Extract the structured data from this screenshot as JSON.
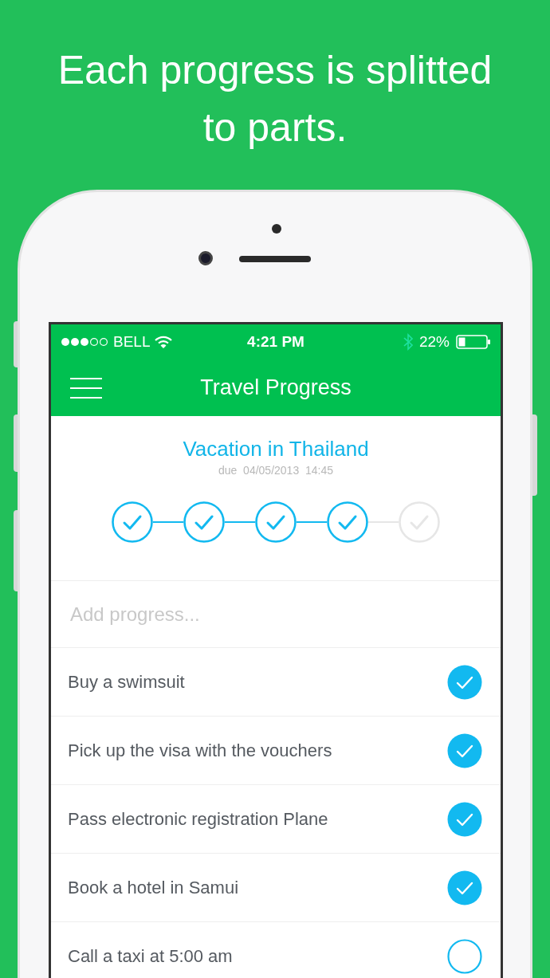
{
  "headline": "Each progress is splitted to parts.",
  "status_bar": {
    "carrier": "BELL",
    "time": "4:21 PM",
    "battery": "22%"
  },
  "nav": {
    "title": "Travel Progress"
  },
  "goal": {
    "title": "Vacation in Thailand",
    "due": "due  04/05/2013  14:45"
  },
  "steps": [
    {
      "done": true
    },
    {
      "done": true
    },
    {
      "done": true
    },
    {
      "done": true
    },
    {
      "done": false
    }
  ],
  "add_field": {
    "placeholder": "Add progress..."
  },
  "tasks": [
    {
      "label": "Buy a swimsuit",
      "checked": true
    },
    {
      "label": "Pick up the visa with the vouchers",
      "checked": true
    },
    {
      "label": "Pass electronic registration Plane",
      "checked": true
    },
    {
      "label": "Book a hotel in Samui",
      "checked": true
    },
    {
      "label": "Call a taxi at 5:00 am",
      "checked": false
    }
  ]
}
